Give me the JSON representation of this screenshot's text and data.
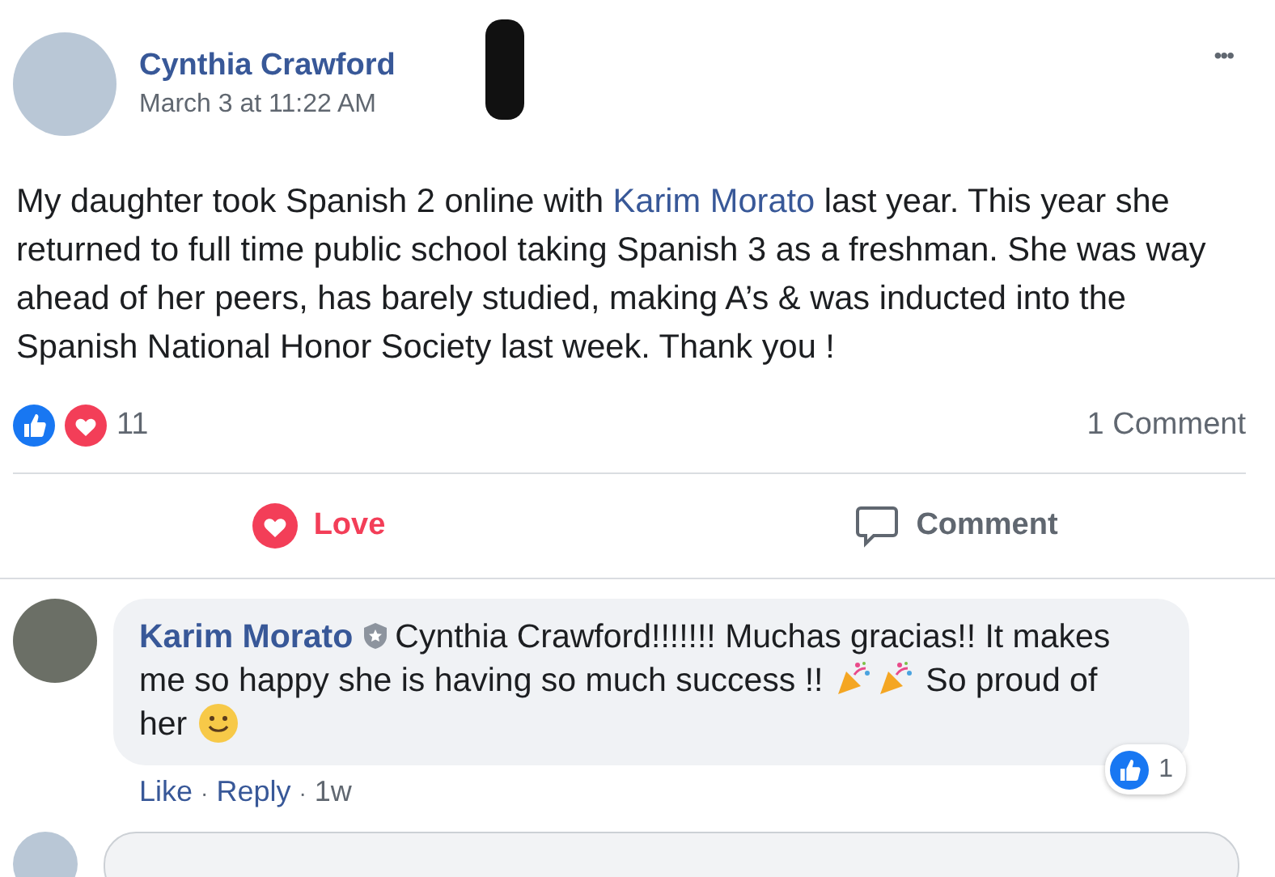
{
  "post": {
    "author": "Cynthia Crawford",
    "time": "March 3 at 11:22 AM",
    "more": "•••",
    "text_before": "My daughter took Spanish 2 online with ",
    "text_link": "Karim Morato",
    "text_after": " last year. This year she returned to full time public school taking Spanish 3 as a freshman. She was way ahead of her peers, has barely studied, making A’s & was inducted into the Spanish National Honor Society last week. Thank you !",
    "reaction_count": "11",
    "comment_count": "1 Comment"
  },
  "actions": [
    {
      "label": "Love",
      "selected": true,
      "kind": "love"
    },
    {
      "label": "Comment",
      "selected": false,
      "kind": "comment"
    }
  ],
  "comment": {
    "author": "Karim Morato",
    "text": "Cynthia Crawford!!!!!!! Muchas gracias!! It makes me so happy she is having so much success !!",
    "text_end": "So proud of her",
    "like_count": "1",
    "separator": "·",
    "links": [
      {
        "label": "Like",
        "kind": "link"
      },
      {
        "label": "Reply",
        "kind": "link"
      },
      {
        "label": "1w",
        "kind": "time"
      }
    ]
  }
}
